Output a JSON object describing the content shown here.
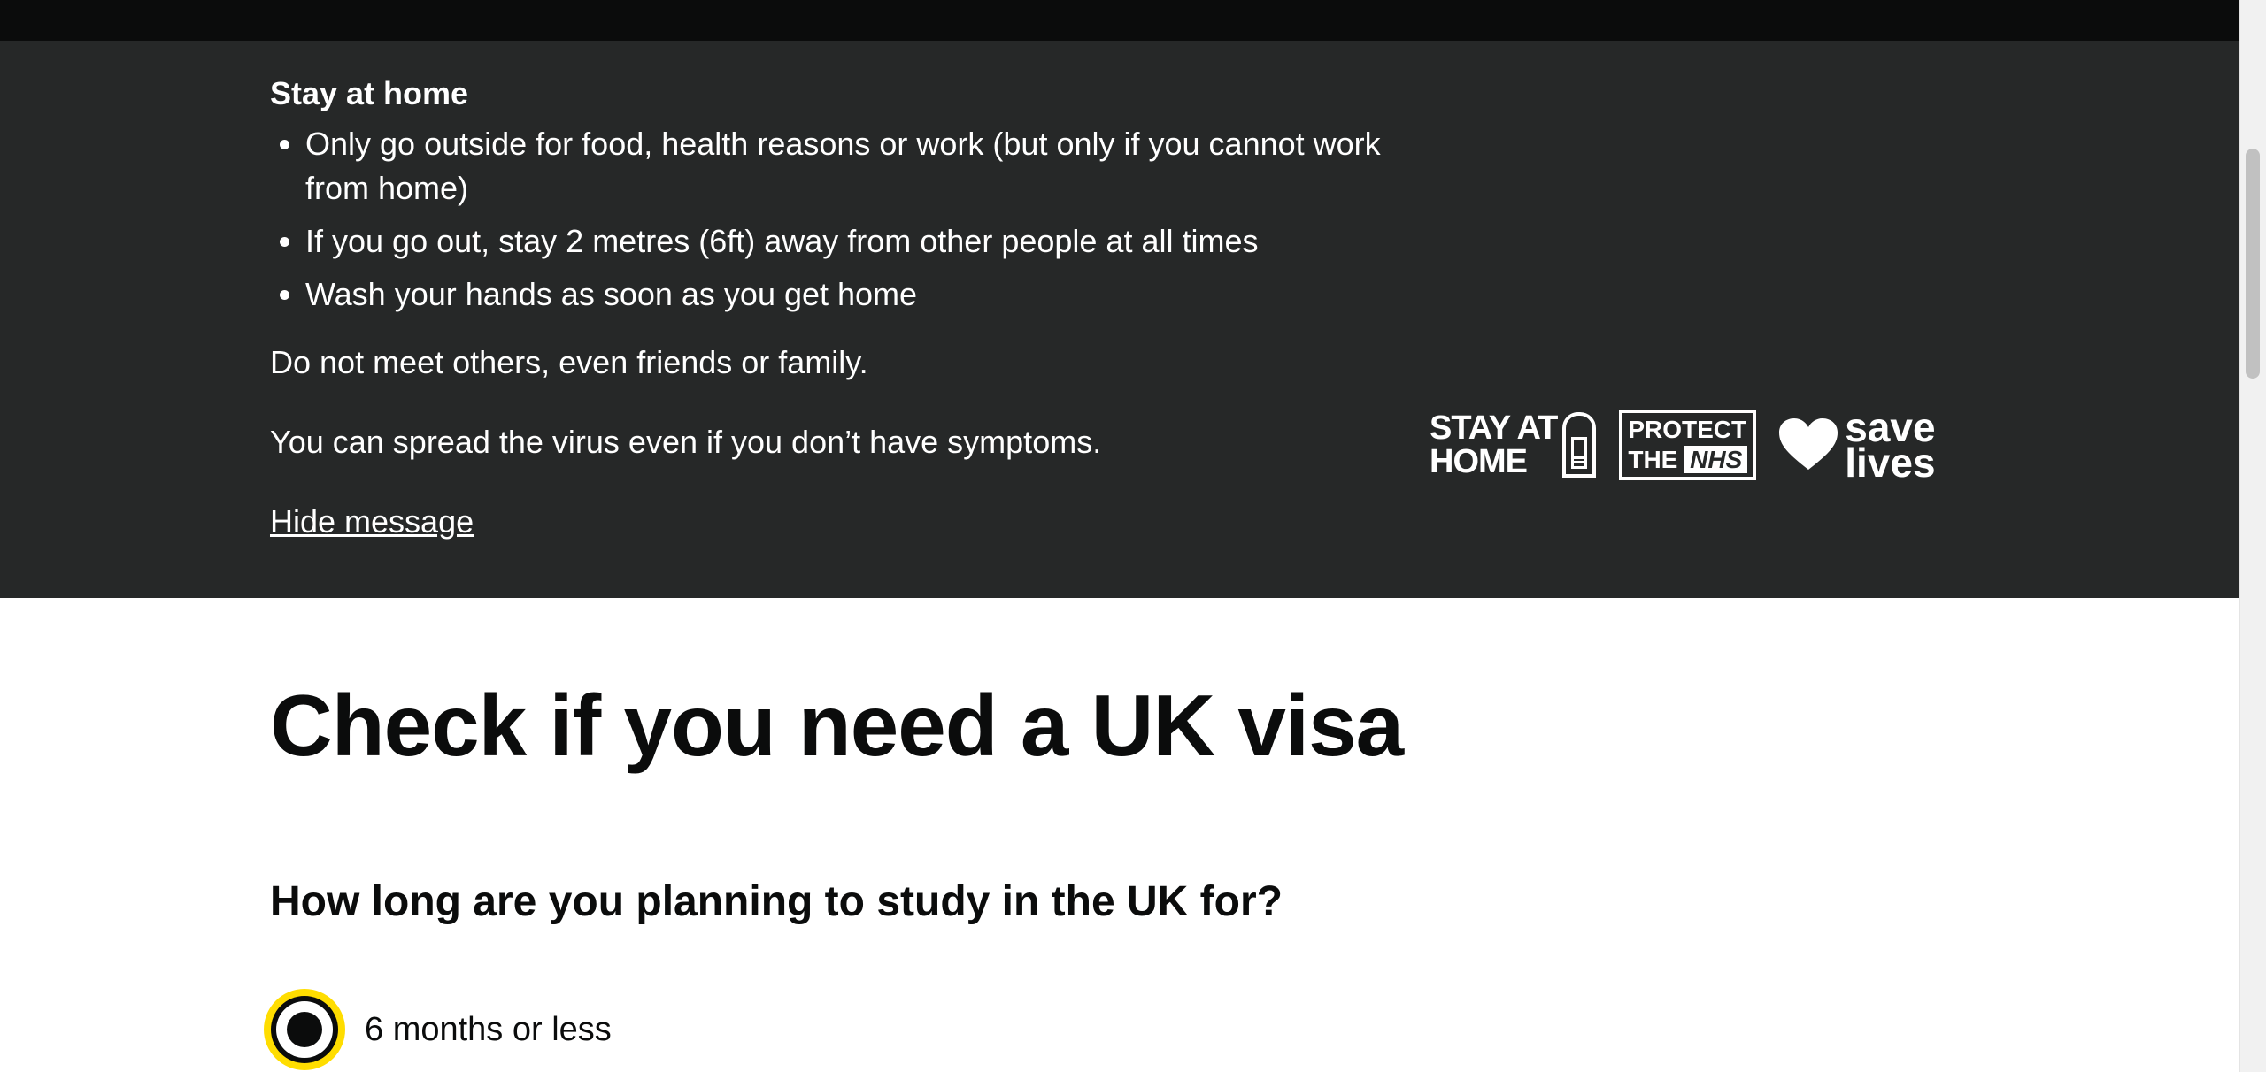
{
  "banner": {
    "title": "Stay at home",
    "items": [
      "Only go outside for food, health reasons or work (but only if you cannot work from home)",
      "If you go out, stay 2 metres (6ft) away from other people at all times",
      "Wash your hands as soon as you get home"
    ],
    "paragraph1": "Do not meet others, even friends or family.",
    "paragraph2": "You can spread the virus even if you don’t have symptoms.",
    "hide_link": "Hide message",
    "campaign": {
      "stay_line1": "STAY AT",
      "stay_line2": "HOME",
      "protect_line1": "PROTECT",
      "protect_the": "THE",
      "protect_nhs": "NHS",
      "save_line1": "save",
      "save_line2": "lives"
    }
  },
  "main": {
    "title": "Check if you need a UK visa",
    "question": "How long are you planning to study in the UK for?",
    "options": [
      {
        "label": "6 months or less",
        "selected": true
      }
    ]
  },
  "colors": {
    "banner_bg": "#262828",
    "topbar_bg": "#0b0c0c",
    "focus": "#ffdd00",
    "text": "#0b0c0c"
  }
}
